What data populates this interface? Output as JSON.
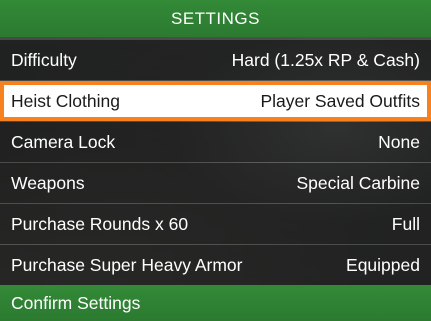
{
  "header": {
    "title": "SETTINGS"
  },
  "settings": [
    {
      "label": "Difficulty",
      "value": "Hard (1.25x RP & Cash)"
    },
    {
      "label": "Heist Clothing",
      "value": "Player Saved Outfits",
      "selected": true
    },
    {
      "label": "Camera Lock",
      "value": "None"
    },
    {
      "label": "Weapons",
      "value": "Special Carbine"
    },
    {
      "label": "Purchase Rounds x 60",
      "value": "Full"
    },
    {
      "label": "Purchase Super Heavy Armor",
      "value": "Equipped"
    }
  ],
  "confirm": {
    "label": "Confirm Settings"
  },
  "colors": {
    "header_green": "#2e7d32",
    "highlight_orange": "#f7811e",
    "row_background": "#0a0a0a"
  }
}
